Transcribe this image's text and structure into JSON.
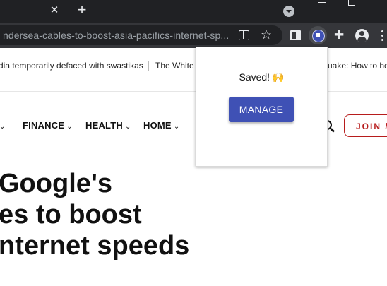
{
  "browser": {
    "tab_close_glyph": "✕",
    "new_tab_glyph": "+",
    "url": "ndersea-cables-to-boost-asia-pacifics-internet-sp...",
    "star_glyph": "☆",
    "puzzle_glyph": "✚"
  },
  "ticker": {
    "items": [
      "dia temporarily defaced with swastikas",
      "The White",
      "uake: How to hel"
    ]
  },
  "nav": {
    "items": [
      {
        "label": ""
      },
      {
        "label": "FINANCE"
      },
      {
        "label": "HEALTH"
      },
      {
        "label": "HOME"
      }
    ],
    "chevron": "⌄",
    "join_label": "JOIN /"
  },
  "headline": {
    "lines": [
      "Google's",
      "es to boost",
      "nternet speeds"
    ]
  },
  "popup": {
    "saved_text": "Saved!",
    "saved_emoji": "🙌",
    "manage_label": "MANAGE"
  },
  "colors": {
    "accent": "#3f51b5",
    "join_red": "#b71c1c",
    "chrome_dark": "#202124",
    "toolbar": "#35363a"
  }
}
